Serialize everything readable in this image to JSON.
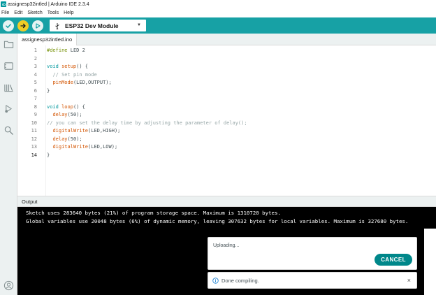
{
  "window": {
    "title": "assignesp32intled | Arduino IDE 2.3.4"
  },
  "menu": {
    "items": [
      "File",
      "Edit",
      "Sketch",
      "Tools",
      "Help"
    ]
  },
  "toolbar": {
    "board": "ESP32 Dev Module",
    "accent_color": "#17a1a5",
    "upload_color": "#f2cc26"
  },
  "tab": {
    "filename": "assignesp32intled.ino"
  },
  "editor": {
    "line_numbers": [
      "1",
      "2",
      "3",
      "4",
      "5",
      "6",
      "7",
      "8",
      "9",
      "10",
      "11",
      "12",
      "13",
      "14"
    ],
    "lines": [
      "#define LED 2",
      "",
      "void setup() {",
      "  // Set pin mode",
      "  pinMode(LED,OUTPUT);",
      "}",
      "",
      "void loop() {",
      "  delay(50);",
      "// you can set the delay time by adjusting the parameter of delay();",
      "  digitalWrite(LED,HIGH);",
      "  delay(50);",
      "  digitalWrite(LED,LOW);",
      "}"
    ]
  },
  "output": {
    "label": "Output",
    "lines": [
      "Sketch uses 283640 bytes (21%) of program storage space. Maximum is 1310720 bytes.",
      "Global variables use 20048 bytes (6%) of dynamic memory, leaving 307632 bytes for local variables. Maximum is 327680 bytes."
    ]
  },
  "notifications": {
    "upload_message": "Uploading...",
    "cancel_label": "CANCEL",
    "done_message": "Done compiling.",
    "close_glyph": "×"
  }
}
